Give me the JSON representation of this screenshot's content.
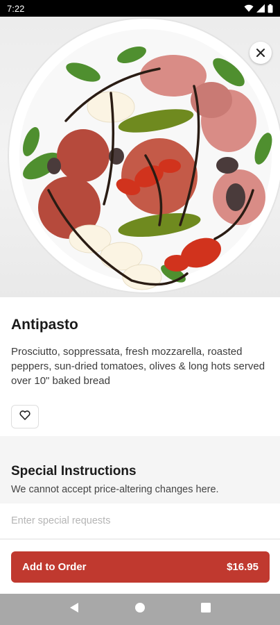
{
  "status_bar": {
    "time": "7:22",
    "icons": [
      "wifi-icon",
      "signal-icon",
      "battery-icon"
    ]
  },
  "hero": {
    "image": "antipasto-platter-photo",
    "close_icon": "close-icon"
  },
  "item": {
    "title": "Antipasto",
    "description": "Prosciutto, soppressata, fresh mozzarella, roasted peppers, sun-dried tomatoes, olives & long hots served over 10\" baked bread",
    "favorite_icon": "heart-icon"
  },
  "instructions": {
    "title": "Special Instructions",
    "subtitle": "We cannot accept price-altering changes here.",
    "placeholder": "Enter special requests",
    "value": ""
  },
  "order": {
    "button_label": "Add to Order",
    "price": "$16.95",
    "accent_color": "#c0392f"
  },
  "nav": {
    "icons": [
      "back-icon",
      "home-icon",
      "recents-icon"
    ]
  }
}
